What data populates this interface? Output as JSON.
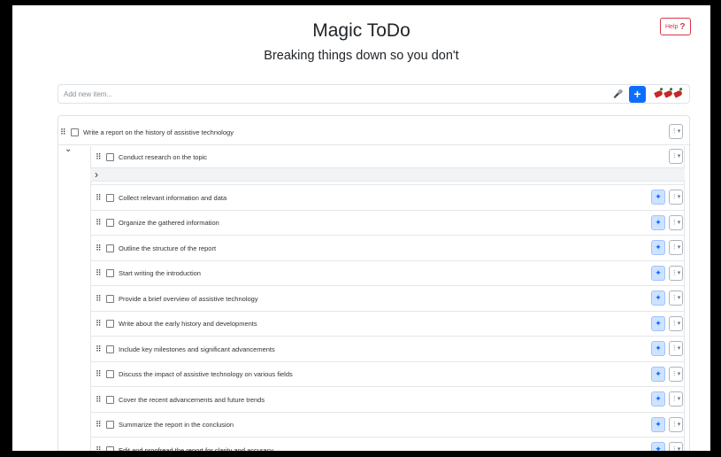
{
  "header": {
    "title": "Magic ToDo",
    "subtitle": "Breaking things down so you don't",
    "help_label": "Help",
    "help_icon": "?"
  },
  "add_item": {
    "placeholder": "Add new item...",
    "mic_icon": "microphone-icon",
    "plus_label": "+",
    "spiciness_icon": "chili-pepper-icon",
    "spiciness_level": 3
  },
  "top_task": {
    "label": "Write a report on the history of assistive technology",
    "checked": false,
    "expanded": true
  },
  "first_subtask": {
    "label": "Conduct research on the topic",
    "checked": false,
    "expanded": false
  },
  "subtasks": [
    {
      "label": "Collect relevant information and data"
    },
    {
      "label": "Organize the gathered information"
    },
    {
      "label": "Outline the structure of the report"
    },
    {
      "label": "Start writing the introduction"
    },
    {
      "label": "Provide a brief overview of assistive technology"
    },
    {
      "label": "Write about the early history and developments"
    },
    {
      "label": "Include key milestones and significant advancements"
    },
    {
      "label": "Discuss the impact of assistive technology on various fields"
    },
    {
      "label": "Cover the recent advancements and future trends"
    },
    {
      "label": "Summarize the report in the conclusion"
    },
    {
      "label": "Edit and proofread the report for clarity and accuracy"
    }
  ],
  "icons": {
    "grip": "⠿",
    "menu": "⋮▾",
    "wand": "magic-wand-icon",
    "chevron_down": "⌄",
    "chevron_right": "›"
  },
  "colors": {
    "primary": "#0d6efd",
    "help": "#dc3545",
    "wand_bg": "#cfe2ff"
  }
}
